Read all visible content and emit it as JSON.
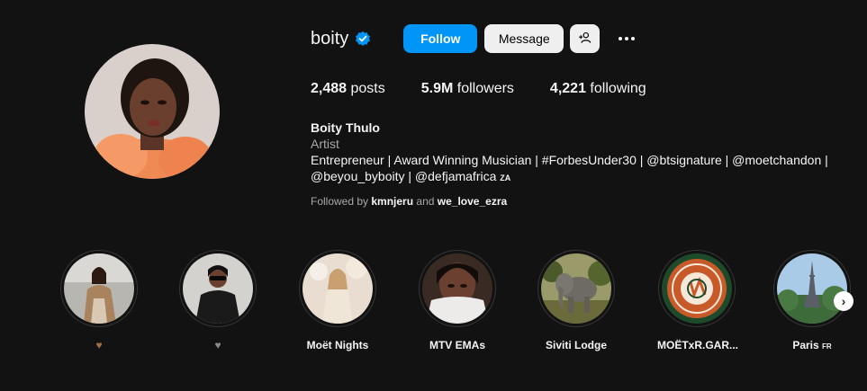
{
  "profile": {
    "username": "boity",
    "verified_icon": "verified-badge-icon",
    "follow_label": "Follow",
    "message_label": "Message",
    "add_user_icon": "add-user-icon",
    "more_icon": "more-options-icon",
    "accent_color": "#0095f6"
  },
  "stats": {
    "posts_count": "2,488",
    "posts_label": "posts",
    "followers_count": "5.9M",
    "followers_label": "followers",
    "following_count": "4,221",
    "following_label": "following"
  },
  "bio": {
    "full_name": "Boity Thulo",
    "category": "Artist",
    "line1": "Entrepreneur | Award Winning Musician | #ForbesUnder30 | @btsignature | @moetchandon |",
    "line2": "@beyou_byboity | @defjamafrica",
    "line2_suffix": "ZA",
    "followed_by_prefix": "Followed by",
    "followed_by_user1": "kmnjeru",
    "followed_by_and": "and",
    "followed_by_user2": "we_love_ezra"
  },
  "highlights": [
    {
      "label": "♥",
      "label_color": "#a0704a"
    },
    {
      "label": "♥",
      "label_color": "#8a8a8a"
    },
    {
      "label": "Moët Nights"
    },
    {
      "label": "MTV EMAs"
    },
    {
      "label": "Siviti Lodge"
    },
    {
      "label": "MOËTxR.GAR..."
    },
    {
      "label": "Paris",
      "label_suffix": "FR"
    }
  ],
  "highlights_next_icon": "chevron-right-icon"
}
